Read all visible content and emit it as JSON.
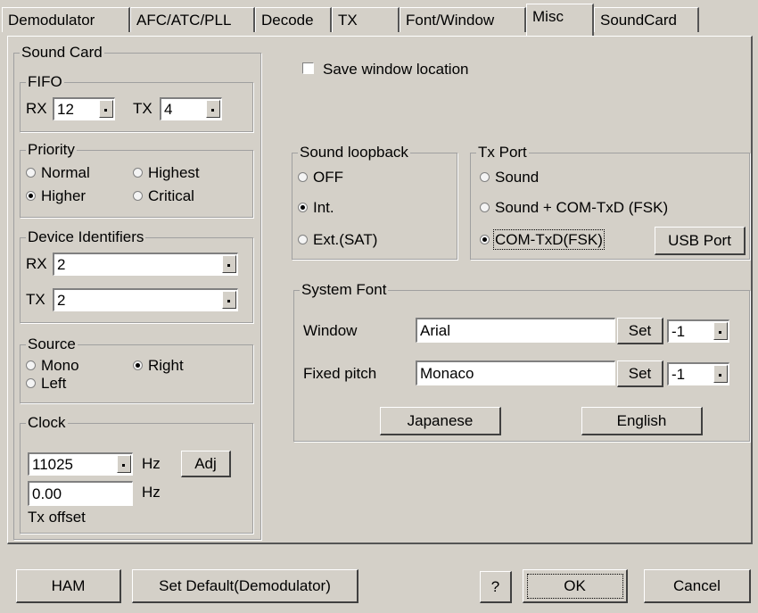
{
  "tabs": [
    {
      "label": "Demodulator"
    },
    {
      "label": "AFC/ATC/PLL"
    },
    {
      "label": "Decode"
    },
    {
      "label": "TX"
    },
    {
      "label": "Font/Window"
    },
    {
      "label": "Misc"
    },
    {
      "label": "SoundCard"
    }
  ],
  "active_tab": "Misc",
  "sound_card": {
    "title": "Sound Card",
    "fifo": {
      "title": "FIFO",
      "rx_label": "RX",
      "rx_value": "12",
      "tx_label": "TX",
      "tx_value": "4"
    },
    "priority": {
      "title": "Priority",
      "options": {
        "normal": "Normal",
        "highest": "Highest",
        "higher": "Higher",
        "critical": "Critical"
      },
      "selected": "Higher"
    },
    "device_identifiers": {
      "title": "Device Identifiers",
      "rx_label": "RX",
      "rx_value": "2",
      "tx_label": "TX",
      "tx_value": "2"
    },
    "source": {
      "title": "Source",
      "options": {
        "mono": "Mono",
        "right": "Right",
        "left": "Left"
      },
      "selected": "Right"
    },
    "clock": {
      "title": "Clock",
      "rate": "11025",
      "hz": "Hz",
      "adj": "Adj",
      "offset": "0.00",
      "offset_hz": "Hz",
      "offset_label": "Tx offset"
    }
  },
  "save_window_location": {
    "label": "Save window location",
    "checked": false
  },
  "sound_loopback": {
    "title": "Sound loopback",
    "options": {
      "off": "OFF",
      "int": "Int.",
      "ext": "Ext.(SAT)"
    },
    "selected": "Int."
  },
  "tx_port": {
    "title": "Tx Port",
    "options": {
      "sound": "Sound",
      "sound_com": "Sound + COM-TxD (FSK)",
      "com": "COM-TxD(FSK)"
    },
    "selected": "COM-TxD(FSK)",
    "usb_button": "USB Port"
  },
  "system_font": {
    "title": "System Font",
    "window_label": "Window",
    "window_font": "Arial",
    "window_set": "Set",
    "window_size": "-1",
    "fixed_label": "Fixed pitch",
    "fixed_font": "Monaco",
    "fixed_set": "Set",
    "fixed_size": "-1",
    "japanese_button": "Japanese",
    "english_button": "English"
  },
  "footer": {
    "ham": "HAM",
    "set_default": "Set Default(Demodulator)",
    "help": "?",
    "ok": "OK",
    "cancel": "Cancel"
  }
}
